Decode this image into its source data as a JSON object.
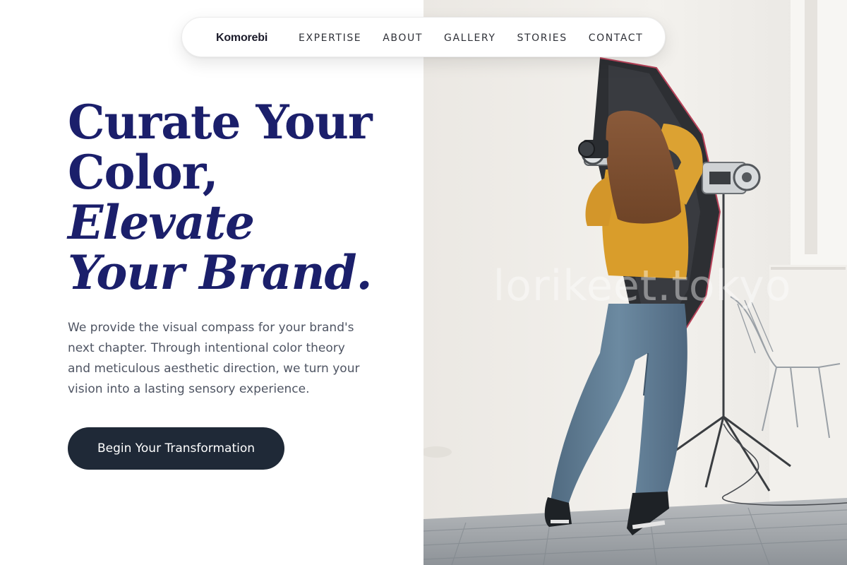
{
  "brand": {
    "name": "Komorebi"
  },
  "nav": {
    "links": [
      {
        "label": "EXPERTISE"
      },
      {
        "label": "ABOUT"
      },
      {
        "label": "GALLERY"
      },
      {
        "label": "STORIES"
      },
      {
        "label": "CONTACT"
      }
    ]
  },
  "hero": {
    "headline": {
      "line1": "Curate Your",
      "line2": "Color,",
      "line3": "Elevate",
      "line4": "Your Brand."
    },
    "description": "We provide the visual compass for your brand's next chapter. Through intentional color theory and meticulous aesthetic direction, we turn your vision into a lasting sensory experience.",
    "cta_label": "Begin Your Transformation"
  },
  "photo": {
    "watermark": "lorikeet.tokyo"
  },
  "colors": {
    "headline": "#1b1f6b",
    "cta_background": "#1f2937",
    "body_text": "#4f5563"
  }
}
